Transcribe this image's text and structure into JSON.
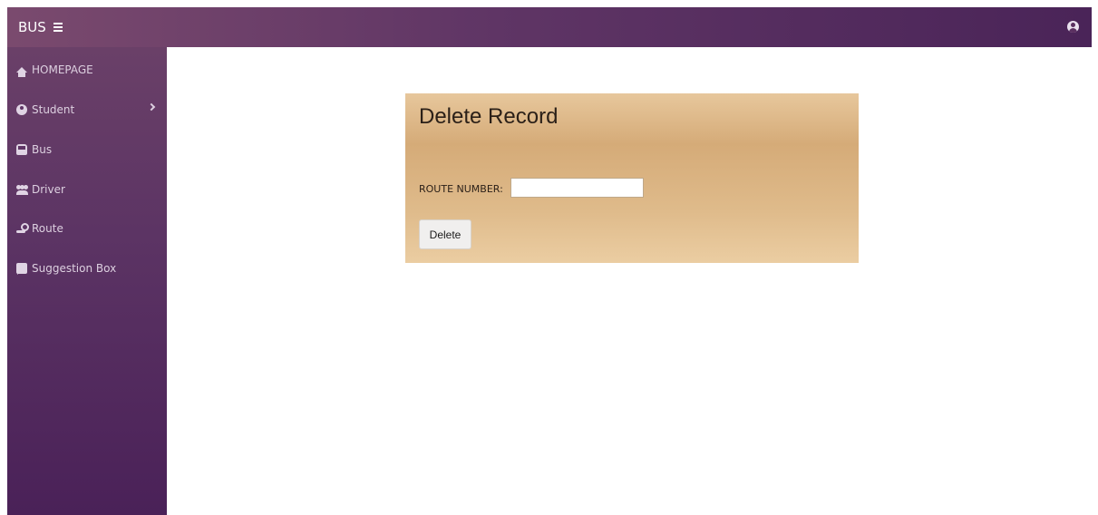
{
  "header": {
    "brand": "BUS",
    "menu_icon": "hamburger-icon",
    "user_icon": "user-circle-icon",
    "colors": {
      "start": "#7a4a6e",
      "end": "#4a2458"
    }
  },
  "sidebar": {
    "items": [
      {
        "label": "HOMEPAGE",
        "icon": "home-icon"
      },
      {
        "label": "Student",
        "icon": "user-circle-icon",
        "has_submenu": true
      },
      {
        "label": "Bus",
        "icon": "bus-icon"
      },
      {
        "label": "Driver",
        "icon": "users-icon"
      },
      {
        "label": "Route",
        "icon": "route-icon"
      },
      {
        "label": "Suggestion Box",
        "icon": "comment-icon"
      }
    ]
  },
  "card": {
    "title": "Delete Record",
    "field_label": "ROUTE NUMBER:",
    "field_value": "",
    "button_label": "Delete",
    "color": "#d5ab78"
  }
}
